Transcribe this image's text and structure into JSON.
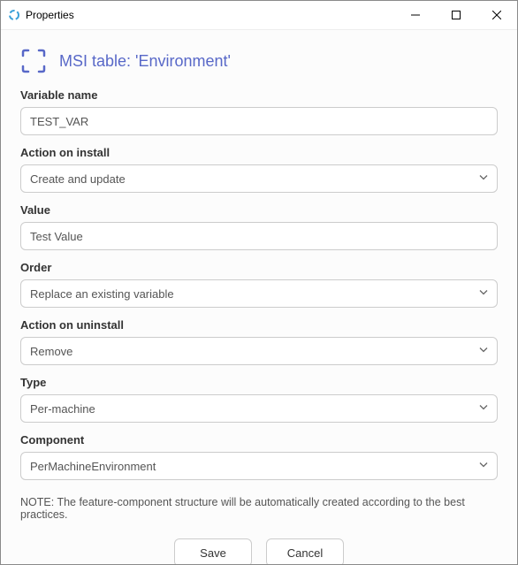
{
  "titlebar": {
    "title": "Properties"
  },
  "header": {
    "title": "MSI table: 'Environment'"
  },
  "fields": {
    "variable_name": {
      "label": "Variable name",
      "value": "TEST_VAR"
    },
    "action_install": {
      "label": "Action on install",
      "value": "Create and update"
    },
    "value": {
      "label": "Value",
      "value": "Test Value"
    },
    "order": {
      "label": "Order",
      "value": "Replace an existing variable"
    },
    "action_uninstall": {
      "label": "Action on uninstall",
      "value": "Remove"
    },
    "type": {
      "label": "Type",
      "value": "Per-machine"
    },
    "component": {
      "label": "Component",
      "value": "PerMachineEnvironment"
    }
  },
  "note": "NOTE: The feature-component structure will be automatically created according to the best practices.",
  "buttons": {
    "save": "Save",
    "cancel": "Cancel"
  }
}
